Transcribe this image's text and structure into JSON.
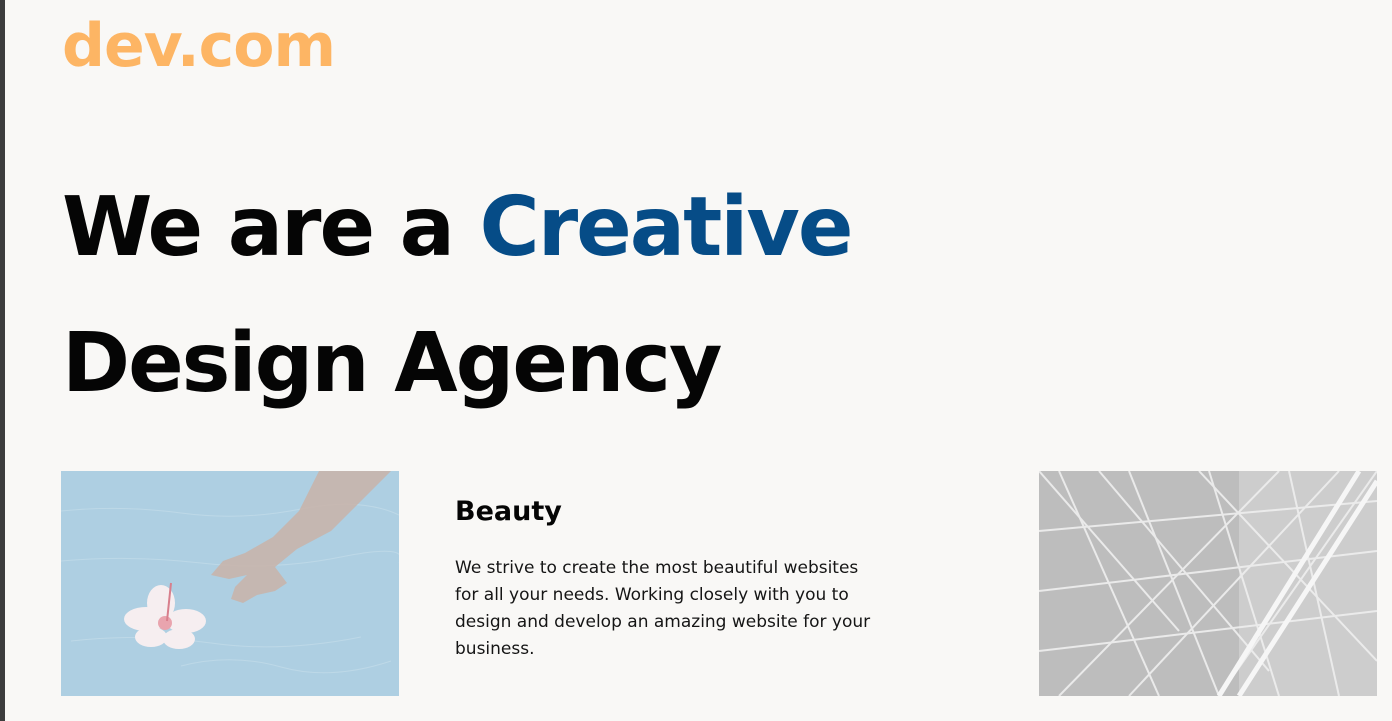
{
  "header": {
    "logo_text": "dev.com"
  },
  "hero": {
    "line1_text": "We are a ",
    "line1_accent": "Creative",
    "line2_text": "Design Agency",
    "accent_color": "#064c87"
  },
  "feature": {
    "title": "Beauty",
    "description": "We strive to create the most beautiful websites for all your needs. Working closely with you to design and develop an amazing website for your business."
  },
  "images": {
    "left": "hand-touching-water-with-hibiscus-flower-photo",
    "right": "steel-lattice-structure-photo"
  },
  "colors": {
    "logo": "#fdb564",
    "background": "#f9f8f6",
    "text": "#050505"
  }
}
